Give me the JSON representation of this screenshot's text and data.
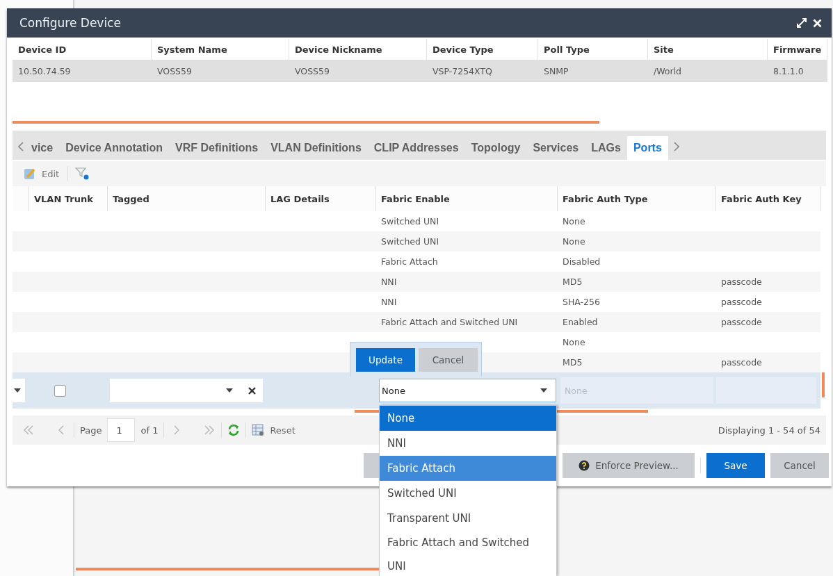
{
  "window": {
    "title": "Configure Device"
  },
  "device_table": {
    "columns": [
      "Device ID",
      "System Name",
      "Device Nickname",
      "Device Type",
      "Poll Type",
      "Site",
      "Firmware"
    ],
    "rows": [
      [
        "10.50.74.59",
        "VOSS59",
        "VOSS59",
        "VSP-7254XTQ",
        "SNMP",
        "/World",
        "8.1.1.0"
      ]
    ]
  },
  "tabs": [
    {
      "label": "vice",
      "selected": false
    },
    {
      "label": "Device Annotation",
      "selected": false
    },
    {
      "label": "VRF Definitions",
      "selected": false
    },
    {
      "label": "VLAN Definitions",
      "selected": false
    },
    {
      "label": "CLIP Addresses",
      "selected": false
    },
    {
      "label": "Topology",
      "selected": false
    },
    {
      "label": "Services",
      "selected": false
    },
    {
      "label": "LAGs",
      "selected": false
    },
    {
      "label": "Ports",
      "selected": true
    }
  ],
  "toolbar": {
    "edit_label": "Edit"
  },
  "ports_grid": {
    "columns": [
      "VLAN Trunk",
      "Tagged",
      "LAG Details",
      "Fabric Enable",
      "Fabric Auth Type",
      "Fabric Auth Key"
    ],
    "rows": [
      {
        "fabric_enable": "Switched UNI",
        "fabric_auth_type": "None"
      },
      {
        "fabric_enable": "Switched UNI",
        "fabric_auth_type": "None"
      },
      {
        "fabric_enable": "Fabric Attach",
        "fabric_auth_type": "Disabled"
      },
      {
        "fabric_enable": "NNI",
        "fabric_auth_type": "MD5",
        "fabric_auth_key": "passcode"
      },
      {
        "fabric_enable": "NNI",
        "fabric_auth_type": "SHA-256",
        "fabric_auth_key": "passcode"
      },
      {
        "fabric_enable": "Fabric Attach and Switched UNI",
        "fabric_auth_type": "Enabled",
        "fabric_auth_key": "passcode"
      },
      {
        "fabric_auth_type": "None"
      },
      {
        "fabric_auth_type": "MD5",
        "fabric_auth_key": "passcode"
      }
    ]
  },
  "editor_row": {
    "trunk_checked": false,
    "fabric_enable": "None",
    "fabric_auth_type": {
      "text": "None",
      "disabled": true
    }
  },
  "row_editor_buttons": [
    "Update",
    "Cancel"
  ],
  "fabric_enable_options": [
    {
      "label": "None",
      "selected": true,
      "highlighted": false
    },
    {
      "label": "NNI",
      "selected": false,
      "highlighted": false
    },
    {
      "label": "Fabric Attach",
      "selected": false,
      "highlighted": true
    },
    {
      "label": "Switched UNI",
      "selected": false,
      "highlighted": false
    },
    {
      "label": "Transparent UNI",
      "selected": false,
      "highlighted": false
    },
    {
      "label": "Fabric Attach and Switched UNI",
      "selected": false,
      "highlighted": false
    }
  ],
  "pager": {
    "page_label": "Page",
    "page": "1",
    "of_label": "of 1",
    "reset_label": "Reset",
    "display_info": "Displaying 1 - 54 of 54",
    "nav_disabled": true
  },
  "footer_buttons": [
    {
      "label": "Enforce Preview...",
      "kind": "preview"
    },
    {
      "label": "Save",
      "kind": "primary"
    },
    {
      "label": "Cancel",
      "kind": "secondary"
    }
  ]
}
